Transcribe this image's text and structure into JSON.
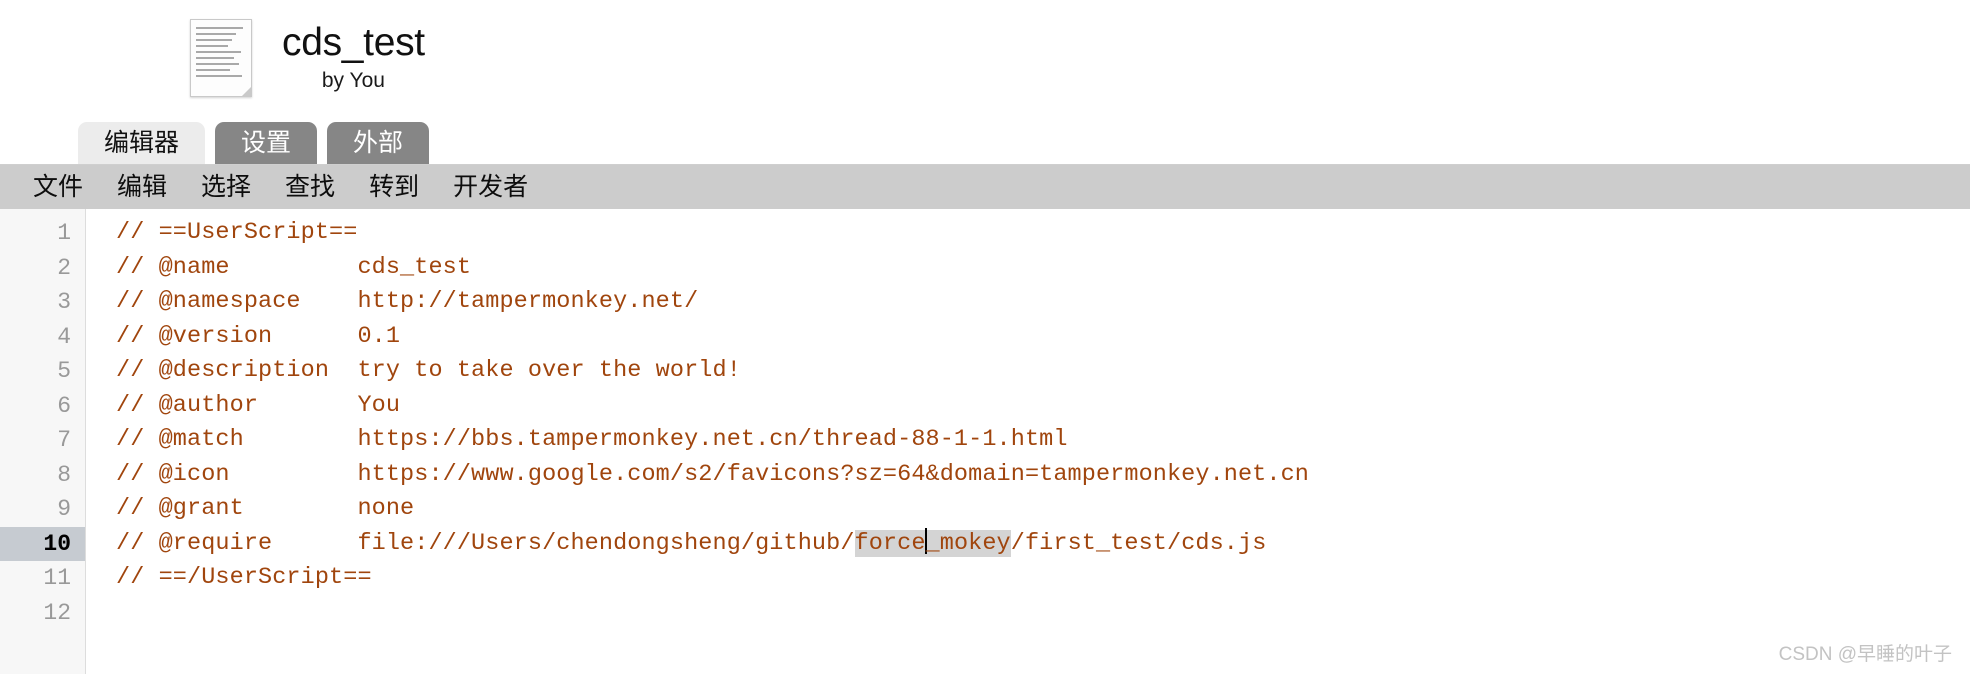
{
  "header": {
    "icon_name": "script-document-icon",
    "title": "cds_test",
    "subtitle": "by You"
  },
  "tabs": [
    {
      "label": "编辑器",
      "active": true
    },
    {
      "label": "设置",
      "active": false
    },
    {
      "label": "外部",
      "active": false
    }
  ],
  "menubar": {
    "items": [
      {
        "label": "文件"
      },
      {
        "label": "编辑"
      },
      {
        "label": "选择"
      },
      {
        "label": "查找"
      },
      {
        "label": "转到"
      },
      {
        "label": "开发者"
      }
    ]
  },
  "editor": {
    "comment_color": "#a0450d",
    "gutter_bg": "#f7f7f7",
    "active_line": 10,
    "selection_bg": "#d4d4d4",
    "line_numbers": [
      "1",
      "2",
      "3",
      "4",
      "5",
      "6",
      "7",
      "8",
      "9",
      "10",
      "11",
      "12"
    ],
    "lines": [
      "// ==UserScript==",
      "// @name         cds_test",
      "// @namespace    http://tampermonkey.net/",
      "// @version      0.1",
      "// @description  try to take over the world!",
      "// @author       You",
      "// @match        https://bbs.tampermonkey.net.cn/thread-88-1-1.html",
      "// @icon         https://www.google.com/s2/favicons?sz=64&domain=tampermonkey.net.cn",
      "// @grant        none",
      "// @require      file:///Users/chendongsheng/github/force_mokey/first_test/cds.js",
      "// ==/UserScript==",
      ""
    ],
    "line10": {
      "prefix": "// @require      file:///Users/chendongsheng/github/",
      "selected_before_caret": "force",
      "selected_after_caret": "_mokey",
      "suffix": "/first_test/cds.js"
    }
  },
  "watermark": {
    "text": "CSDN @早睡的叶子"
  }
}
